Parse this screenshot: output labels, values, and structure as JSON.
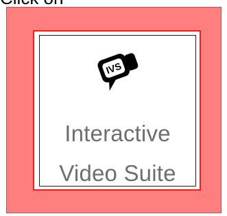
{
  "header": {
    "top_label": "Click on"
  },
  "app": {
    "name_line1": "Interactive",
    "name_line2": "Video Suite",
    "icon": "ivs-video-chat-icon"
  },
  "colors": {
    "highlight_overlay": "#ff7f7f",
    "frame_red": "#ff1a1a",
    "label_gray": "#6b6e73",
    "icon_black": "#000000"
  }
}
